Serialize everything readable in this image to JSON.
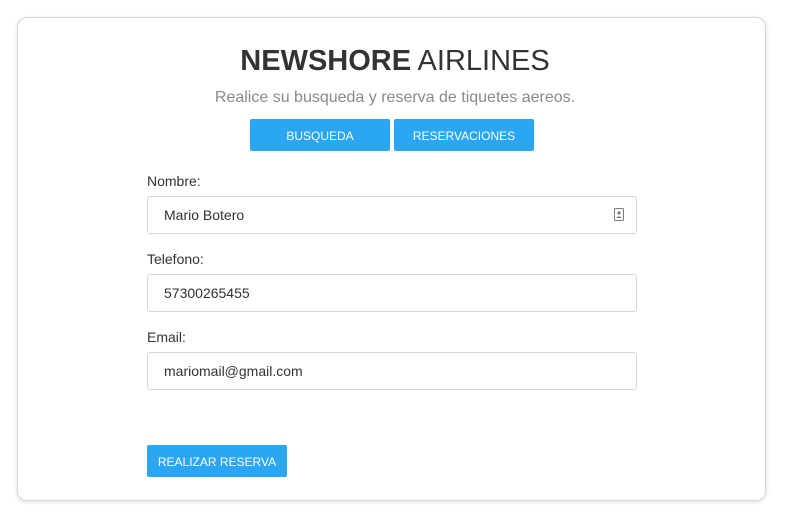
{
  "header": {
    "title_bold": "NEWSHORE",
    "title_rest": "AIRLINES",
    "subtitle": "Realice su busqueda y reserva de tiquetes aereos."
  },
  "nav": {
    "busqueda_label": "BUSQUEDA",
    "reservaciones_label": "RESERVACIONES"
  },
  "form": {
    "nombre_label": "Nombre:",
    "nombre_value": "Mario Botero",
    "nombre_icon": "contact-card-icon",
    "telefono_label": "Telefono:",
    "telefono_value": "57300265455",
    "email_label": "Email:",
    "email_value": "mariomail@gmail.com",
    "submit_label": "REALIZAR RESERVA"
  },
  "colors": {
    "accent": "#2ba6f5",
    "title": "#333333",
    "subtitle": "#8a8a8a",
    "border": "#d6d6d6"
  }
}
